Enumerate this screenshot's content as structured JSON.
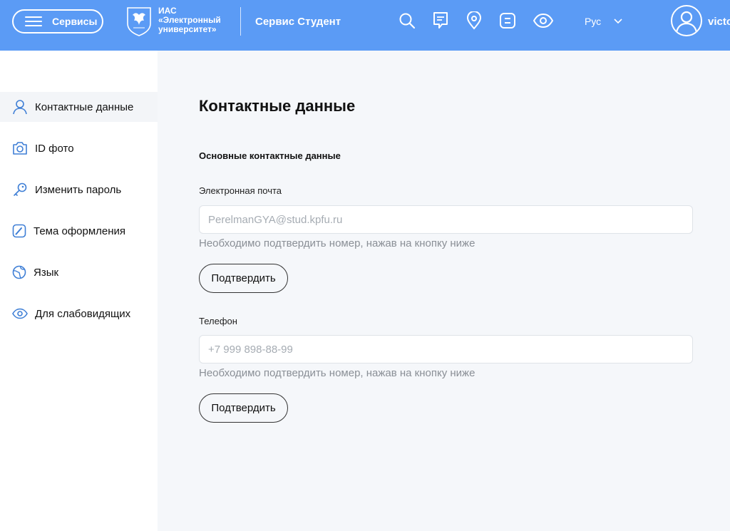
{
  "header": {
    "services_label": "Сервисы",
    "logo_line1": "ИАС",
    "logo_line2": "«Электронный",
    "logo_line3": "университет»",
    "service_title": "Сервис Студент",
    "icons": [
      "search-icon",
      "chat-icon",
      "location-icon",
      "list-icon",
      "eye-icon"
    ],
    "language": "Рус",
    "username": "victo"
  },
  "sidebar": {
    "items": [
      {
        "label": "Контактные данные",
        "icon": "user-icon",
        "active": true
      },
      {
        "label": "ID фото",
        "icon": "camera-icon",
        "active": false
      },
      {
        "label": "Изменить пароль",
        "icon": "key-icon",
        "active": false
      },
      {
        "label": "Тема оформления",
        "icon": "brush-icon",
        "active": false
      },
      {
        "label": "Язык",
        "icon": "globe-icon",
        "active": false
      },
      {
        "label": "Для слабовидящих",
        "icon": "eye-icon",
        "active": false
      }
    ]
  },
  "main": {
    "title": "Контактные данные",
    "section_title": "Основные контактные данные",
    "email": {
      "label": "Электронная почта",
      "placeholder": "PerelmanGYA@stud.kpfu.ru",
      "value": "",
      "hint": "Необходимо подтвердить номер, нажав на кнопку ниже",
      "button": "Подтвердить"
    },
    "phone": {
      "label": "Телефон",
      "placeholder": "+7 999 898-88-99",
      "value": "",
      "hint": "Необходимо подтвердить номер, нажав на кнопку ниже",
      "button": "Подтвердить"
    }
  },
  "colors": {
    "header_bg": "#5b9bf5",
    "icon_blue": "#3f7fd6",
    "page_bg": "#f5f7fa"
  }
}
